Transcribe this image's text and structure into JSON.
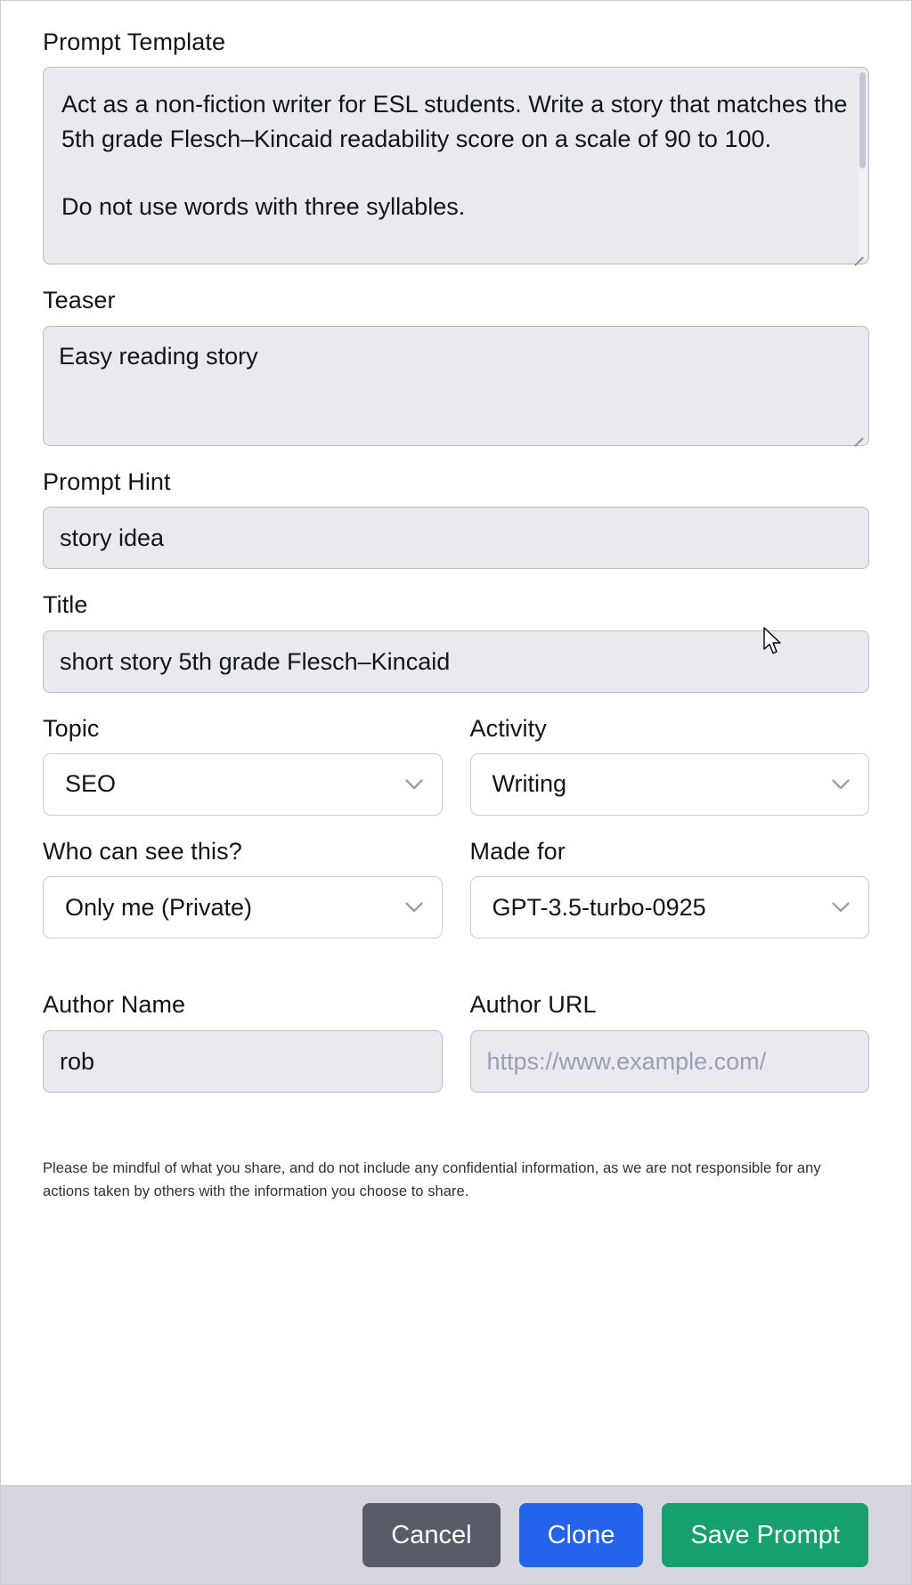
{
  "form": {
    "prompt_template": {
      "label": "Prompt Template",
      "value": "Act as a non-fiction writer for ESL students. Write a story that matches the 5th grade Flesch–Kincaid readability score on a scale of 90 to 100.\n\nDo not use words with three syllables."
    },
    "teaser": {
      "label": "Teaser",
      "value": "Easy reading story"
    },
    "prompt_hint": {
      "label": "Prompt Hint",
      "value": "story idea"
    },
    "title": {
      "label": "Title",
      "value": "short story 5th grade Flesch–Kincaid"
    },
    "topic": {
      "label": "Topic",
      "value": "SEO"
    },
    "activity": {
      "label": "Activity",
      "value": "Writing"
    },
    "visibility": {
      "label": "Who can see this?",
      "value": "Only me (Private)"
    },
    "made_for": {
      "label": "Made for",
      "value": "GPT-3.5-turbo-0925"
    },
    "author_name": {
      "label": "Author Name",
      "value": "rob"
    },
    "author_url": {
      "label": "Author URL",
      "value": "",
      "placeholder": "https://www.example.com/"
    },
    "disclaimer": "Please be mindful of what you share, and do not include any confidential information, as we are not responsible for any actions taken by others with the information you choose to share."
  },
  "footer": {
    "cancel_label": "Cancel",
    "clone_label": "Clone",
    "save_label": "Save Prompt"
  },
  "colors": {
    "cancel": "#585c66",
    "clone": "#2563eb",
    "save": "#16a06e",
    "field_fill": "#e9eaef",
    "footer_bg": "#d6d7de"
  }
}
